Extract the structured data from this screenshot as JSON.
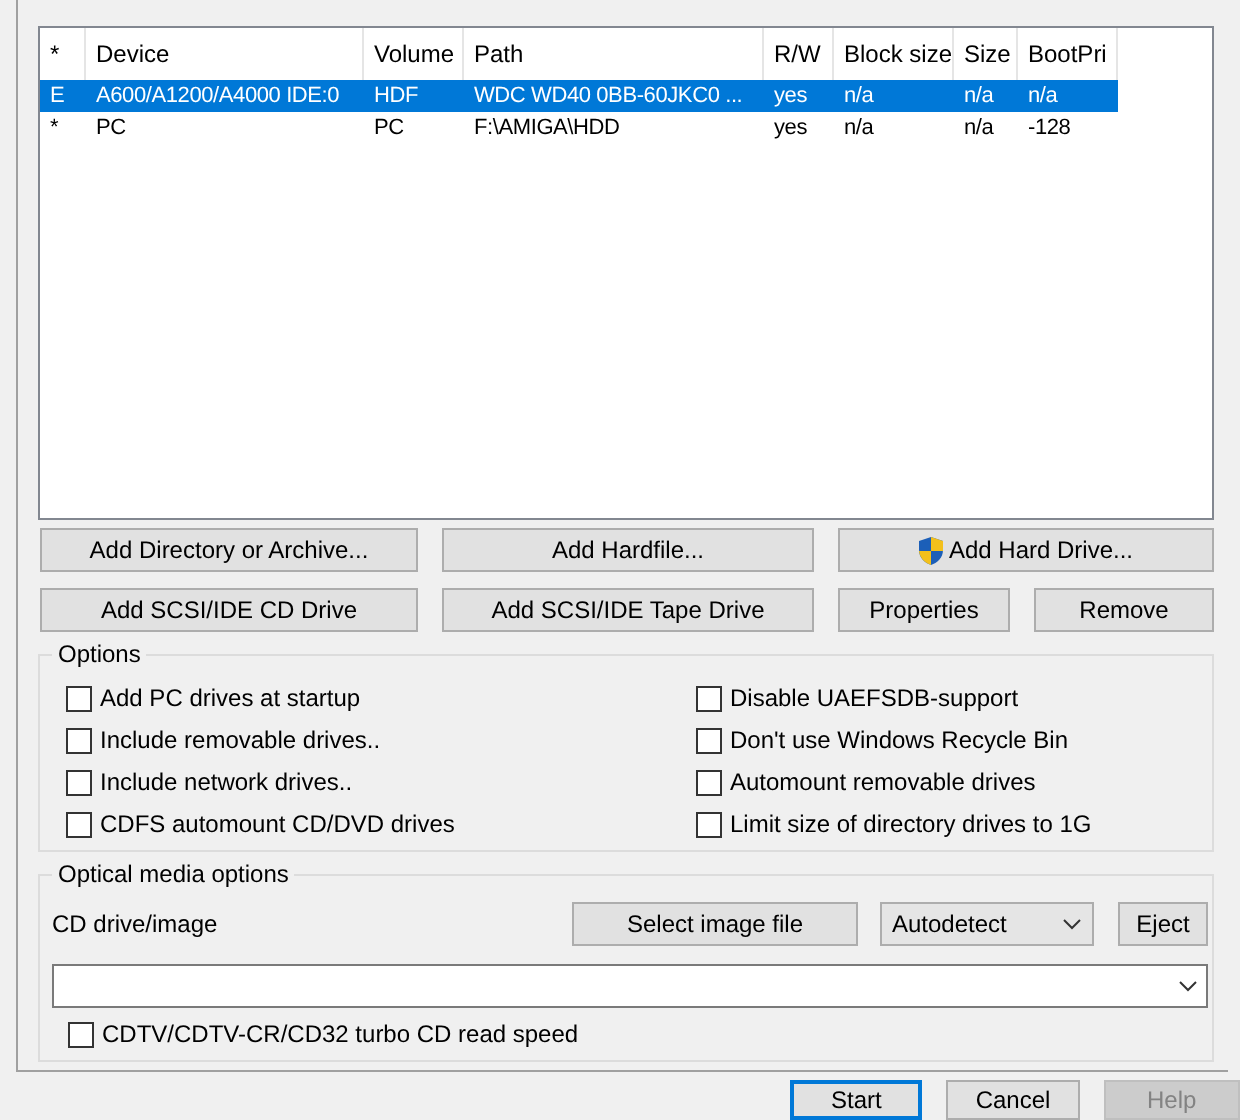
{
  "drives": {
    "columns": [
      "*",
      "Device",
      "Volume",
      "Path",
      "R/W",
      "Block size",
      "Size",
      "BootPri"
    ],
    "rows": [
      {
        "selected": true,
        "cells": [
          "E",
          "A600/A1200/A4000 IDE:0",
          "HDF",
          "WDC WD40 0BB-60JKC0 ...",
          "yes",
          "n/a",
          "n/a",
          "n/a"
        ]
      },
      {
        "selected": false,
        "cells": [
          "*",
          "PC",
          "PC",
          "F:\\AMIGA\\HDD",
          "yes",
          "n/a",
          "n/a",
          "-128"
        ]
      }
    ]
  },
  "drive_buttons": [
    [
      {
        "label": "Add Directory or Archive...",
        "shield": false
      },
      {
        "label": "Add Hardfile...",
        "shield": false
      },
      {
        "label": "Add Hard Drive...",
        "shield": true
      }
    ],
    [
      {
        "label": "Add SCSI/IDE CD Drive",
        "shield": false
      },
      {
        "label": "Add SCSI/IDE Tape Drive",
        "shield": false
      },
      {
        "label": "Properties",
        "shield": false
      },
      {
        "label": "Remove",
        "shield": false
      }
    ]
  ],
  "options": {
    "title": "Options",
    "left": [
      {
        "label": "Add PC drives at startup",
        "checked": false
      },
      {
        "label": "Include removable drives..",
        "checked": false
      },
      {
        "label": "Include network drives..",
        "checked": false
      },
      {
        "label": "CDFS automount CD/DVD drives",
        "checked": false
      }
    ],
    "right": [
      {
        "label": "Disable UAEFSDB-support",
        "checked": false
      },
      {
        "label": "Don't use Windows Recycle Bin",
        "checked": false
      },
      {
        "label": "Automount removable drives",
        "checked": false
      },
      {
        "label": "Limit size of directory drives to 1G",
        "checked": false
      }
    ]
  },
  "optical": {
    "title": "Optical media options",
    "label": "CD drive/image",
    "select_button": "Select image file",
    "mode": "Autodetect",
    "eject_button": "Eject",
    "turbo": {
      "label": "CDTV/CDTV-CR/CD32 turbo CD read speed",
      "checked": false
    }
  },
  "footer": [
    {
      "label": "Start",
      "default": true,
      "disabled": false
    },
    {
      "label": "Cancel",
      "default": false,
      "disabled": false
    },
    {
      "label": "Help",
      "default": false,
      "disabled": true
    }
  ]
}
